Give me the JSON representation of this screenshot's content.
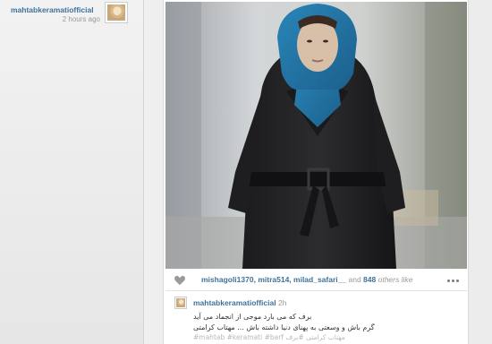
{
  "profile": {
    "username": "mahtabkeramatiofficial",
    "time_ago": "2 hours ago"
  },
  "post": {
    "likes": {
      "users": [
        "mishagoli1370",
        "mitra514",
        "milad_safari__"
      ],
      "and_text": "and",
      "count": "848",
      "more_text": "others like"
    },
    "caption": {
      "username": "mahtabkeramatiofficial",
      "time": "2h",
      "line1": "برف که می بارد موجی از انجماد می آید",
      "line2": "گرم باش و وسعتی به پهنای دنیا داشته باش ... مهتاب کرامتی",
      "hashtags": "#mahtab #keramati #barf مهتاب کرامتی #برف"
    }
  },
  "colors": {
    "link": "#3f729b",
    "muted": "#999999"
  },
  "icons": [
    "heart-icon",
    "more-options-icon"
  ]
}
